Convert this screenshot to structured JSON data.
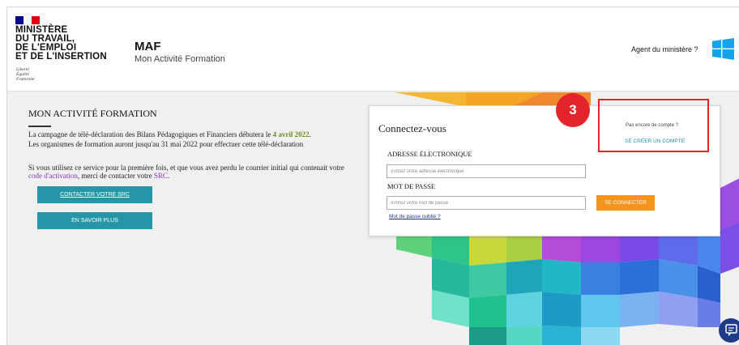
{
  "header": {
    "ministry_lines": [
      "MINISTÈRE",
      "DU TRAVAIL,",
      "DE L'EMPLOI",
      "ET DE L'INSERTION"
    ],
    "motto_lines": [
      "Liberté",
      "Égalité",
      "Fraternité"
    ],
    "app_name": "MAF",
    "app_subtitle": "Mon Activité Formation",
    "agent_link": "Agent du ministère ?"
  },
  "intro": {
    "title": "MON ACTIVITÉ FORMATION",
    "line1_pre": "La campagne de télé-déclaration des Bilans Pédagogiques et Financiers débutera le ",
    "line1_date": "4 avril 2022",
    "line1_post": ".",
    "line2": "Les organismes de formation auront jusqu'au 31 mai 2022 pour effectuer cette télé-déclaration",
    "para2_pre": "Si vous utilisez ce service pour la première fois, et que vous avez perdu le courrier initial qui contenait votre ",
    "para2_link1": "code d'activation",
    "para2_mid": ", merci de contacter votre ",
    "para2_link2": "SRC",
    "para2_post": ".",
    "contact_button": "CONTACTER VOTRE SRC",
    "more_button": "EN SAVOIR PLUS"
  },
  "login": {
    "title": "Connectez-vous",
    "email_label": "ADRESSE ÉLECTRONIQUE",
    "email_placeholder": "Entrez votre adresse électronique",
    "password_label": "MOT DE PASSE",
    "password_placeholder": "Entrez votre mot de passe",
    "forgot_link": "Mot de passe oublié ?",
    "submit_button": "SE CONNECTER",
    "no_account_text": "Pas encore de compte ?",
    "create_account_link": "SE CRÉER UN COMPTE"
  },
  "annotation": {
    "step_number": "3",
    "color": "#e3242b"
  },
  "colors": {
    "teal_button": "#2596a8",
    "orange_button": "#f7941d",
    "link_purple": "#8b2fc9",
    "date_highlight": "#6b8e23",
    "create_account_link": "#1c8fa8"
  }
}
